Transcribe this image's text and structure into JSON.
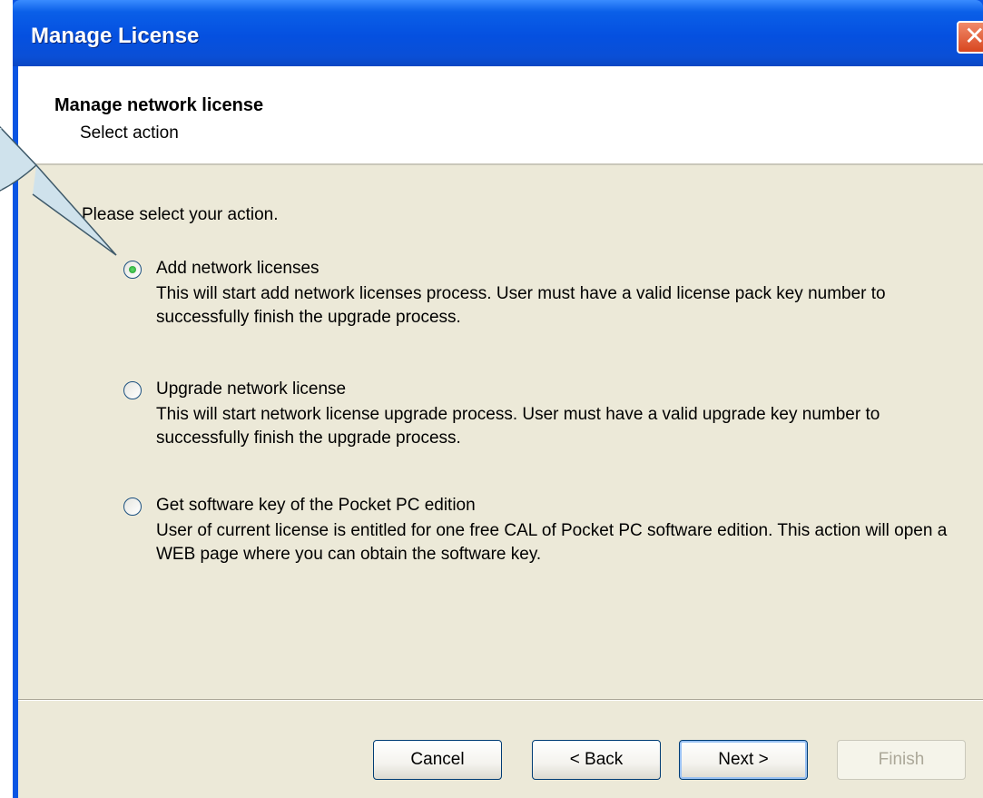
{
  "window": {
    "title": "Manage License",
    "close_glyph": "✕"
  },
  "header": {
    "title": "Manage network license",
    "subtitle": "Select action"
  },
  "prompt": "Please select your action.",
  "options": [
    {
      "label": "Add network licenses",
      "description": "This will start add network licenses process. User must have a valid license pack key number to successfully finish the upgrade process.",
      "checked": true
    },
    {
      "label": "Upgrade network license",
      "description": "This will start network license upgrade process. User must have a valid upgrade key number to successfully finish the upgrade process.",
      "checked": false
    },
    {
      "label": "Get software key of the Pocket PC edition",
      "description": "User of current license is entitled for one free CAL of Pocket PC software edition. This action will open a WEB page where you can obtain the software key.",
      "checked": false
    }
  ],
  "buttons": {
    "cancel": "Cancel",
    "back": "< Back",
    "next": "Next >",
    "finish": "Finish"
  },
  "colors": {
    "titlebar": "#0a55e3",
    "client_bg": "#ece9d8",
    "callout_fill": "#cfe2ec"
  }
}
